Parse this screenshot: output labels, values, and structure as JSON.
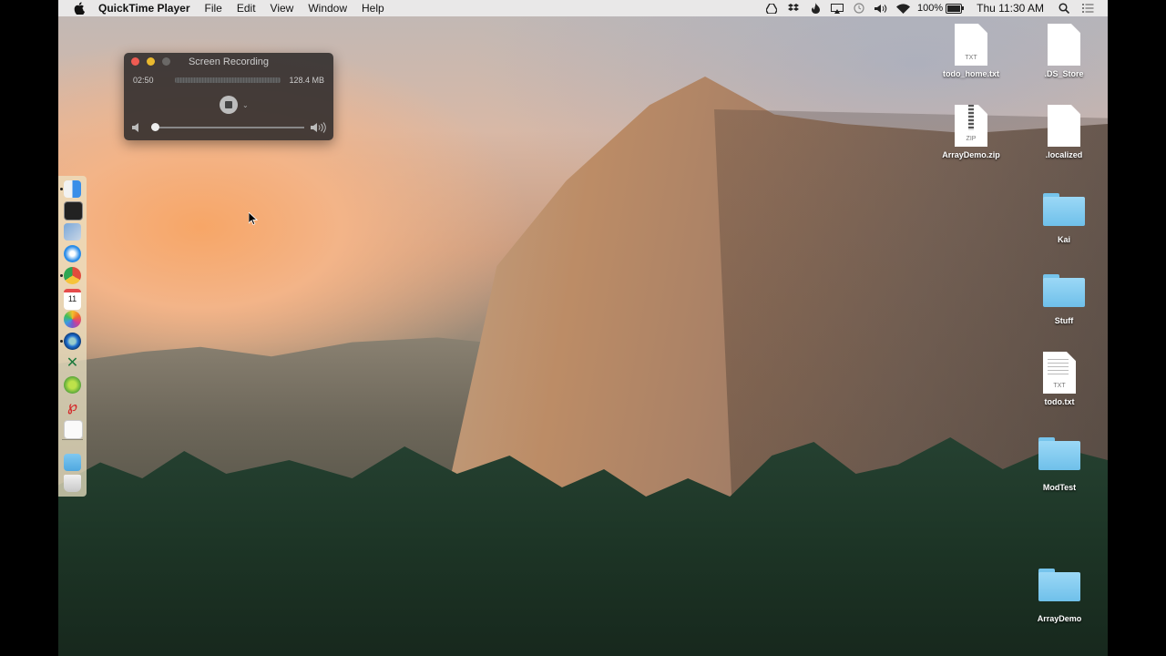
{
  "menubar": {
    "app_name": "QuickTime Player",
    "menus": [
      "File",
      "Edit",
      "View",
      "Window",
      "Help"
    ],
    "status_icons": [
      "google-drive-icon",
      "dropbox-icon",
      "flame-icon",
      "airplay-icon",
      "time-machine-icon",
      "volume-icon",
      "wifi-icon"
    ],
    "battery_percent": "100%",
    "battery_level": 1.0,
    "clock": "Thu 11:30 AM"
  },
  "recording_panel": {
    "title": "Screen Recording",
    "elapsed": "02:50",
    "file_size": "128.4 MB",
    "volume_level": 0.0
  },
  "dock": {
    "apps": [
      "Finder",
      "Terminal",
      "Preview",
      "Safari",
      "Chrome",
      "Calendar",
      "Photos",
      "QuickTime Player",
      "Excel",
      "Atom",
      "Acrobat",
      "TextEdit",
      "Downloads",
      "Trash"
    ],
    "calendar_day": "11"
  },
  "desktop_icons": [
    {
      "label": "todo_home.txt",
      "kind": "txt",
      "ext": "TXT"
    },
    {
      "label": ".DS_Store",
      "kind": "blank"
    },
    {
      "label": "ArrayDemo.zip",
      "kind": "zip",
      "ext": "ZIP"
    },
    {
      "label": ".localized",
      "kind": "blank"
    },
    {
      "label": "Kai",
      "kind": "folder"
    },
    {
      "label": "Stuff",
      "kind": "folder"
    },
    {
      "label": "todo.txt",
      "kind": "txt",
      "ext": "TXT"
    },
    {
      "label": "ModTest",
      "kind": "folder"
    },
    {
      "label": "ArrayDemo",
      "kind": "folder"
    }
  ]
}
